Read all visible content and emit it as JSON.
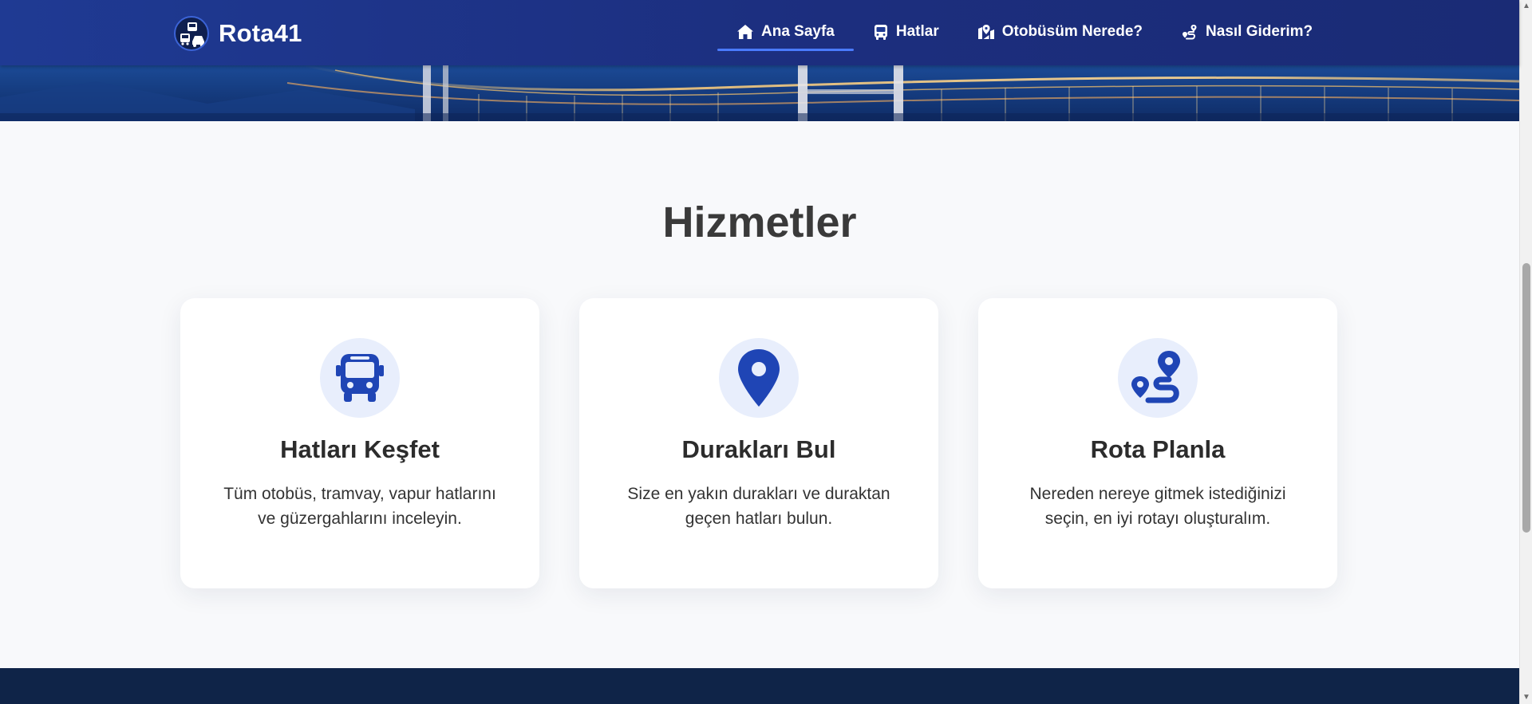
{
  "brand": {
    "name": "Rota41",
    "logo_icon": "transit-logo-icon"
  },
  "nav": {
    "items": [
      {
        "label": "Ana Sayfa",
        "icon": "home-icon",
        "active": true
      },
      {
        "label": "Hatlar",
        "icon": "bus-icon",
        "active": false
      },
      {
        "label": "Otobüsüm Nerede?",
        "icon": "map-location-icon",
        "active": false
      },
      {
        "label": "Nasıl Giderim?",
        "icon": "route-icon",
        "active": false
      }
    ]
  },
  "services": {
    "title": "Hizmetler",
    "cards": [
      {
        "icon": "bus-icon",
        "title": "Hatları Keşfet",
        "text_line1": "Tüm otobüs, tramvay, vapur hatlarını",
        "text_line2": "ve güzergahlarını inceleyin."
      },
      {
        "icon": "location-pin-icon",
        "title": "Durakları Bul",
        "text_line1": "Size en yakın durakları ve duraktan",
        "text_line2": "geçen hatları bulun."
      },
      {
        "icon": "route-icon",
        "title": "Rota Planla",
        "text_line1": "Nereden nereye gitmek istediğinizi",
        "text_line2": "seçin, en iyi rotayı oluşturalım."
      }
    ]
  },
  "colors": {
    "nav_bg": "#1f3a93",
    "accent": "#1f45b5",
    "active_underline": "#4a7bff",
    "page_bg": "#f8f9fb",
    "footer_bg": "#0f2448",
    "icon_circle_bg": "#e8eefc",
    "title_text": "#3a3a3a"
  }
}
